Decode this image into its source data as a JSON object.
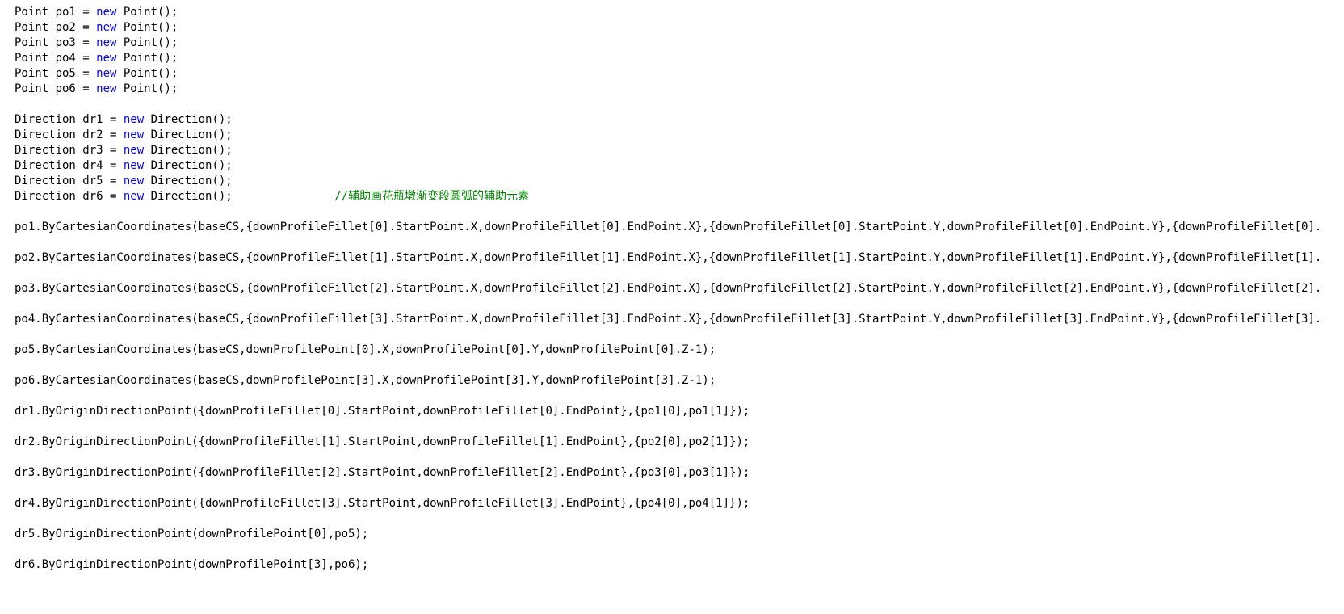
{
  "code": {
    "lines": [
      [
        {
          "t": "Point po1 = "
        },
        {
          "t": "new",
          "c": "kw"
        },
        {
          "t": " Point();"
        }
      ],
      [
        {
          "t": "Point po2 = "
        },
        {
          "t": "new",
          "c": "kw"
        },
        {
          "t": " Point();"
        }
      ],
      [
        {
          "t": "Point po3 = "
        },
        {
          "t": "new",
          "c": "kw"
        },
        {
          "t": " Point();"
        }
      ],
      [
        {
          "t": "Point po4 = "
        },
        {
          "t": "new",
          "c": "kw"
        },
        {
          "t": " Point();"
        }
      ],
      [
        {
          "t": "Point po5 = "
        },
        {
          "t": "new",
          "c": "kw"
        },
        {
          "t": " Point();"
        }
      ],
      [
        {
          "t": "Point po6 = "
        },
        {
          "t": "new",
          "c": "kw"
        },
        {
          "t": " Point();"
        }
      ],
      [
        {
          "t": ""
        }
      ],
      [
        {
          "t": "Direction dr1 = "
        },
        {
          "t": "new",
          "c": "kw"
        },
        {
          "t": " Direction();"
        }
      ],
      [
        {
          "t": "Direction dr2 = "
        },
        {
          "t": "new",
          "c": "kw"
        },
        {
          "t": " Direction();"
        }
      ],
      [
        {
          "t": "Direction dr3 = "
        },
        {
          "t": "new",
          "c": "kw"
        },
        {
          "t": " Direction();"
        }
      ],
      [
        {
          "t": "Direction dr4 = "
        },
        {
          "t": "new",
          "c": "kw"
        },
        {
          "t": " Direction();"
        }
      ],
      [
        {
          "t": "Direction dr5 = "
        },
        {
          "t": "new",
          "c": "kw"
        },
        {
          "t": " Direction();"
        }
      ],
      [
        {
          "t": "Direction dr6 = "
        },
        {
          "t": "new",
          "c": "kw"
        },
        {
          "t": " Direction();               "
        },
        {
          "t": "//辅助画花瓶墩渐变段圆弧的辅助元素",
          "c": "cm"
        }
      ],
      [
        {
          "t": ""
        }
      ],
      [
        {
          "t": "po1.ByCartesianCoordinates(baseCS,{downProfileFillet[0].StartPoint.X,downProfileFillet[0].EndPoint.X},{downProfileFillet[0].StartPoint.Y,downProfileFillet[0].EndPoint.Y},{downProfileFillet[0]."
        }
      ],
      [
        {
          "t": ""
        }
      ],
      [
        {
          "t": "po2.ByCartesianCoordinates(baseCS,{downProfileFillet[1].StartPoint.X,downProfileFillet[1].EndPoint.X},{downProfileFillet[1].StartPoint.Y,downProfileFillet[1].EndPoint.Y},{downProfileFillet[1]."
        }
      ],
      [
        {
          "t": ""
        }
      ],
      [
        {
          "t": "po3.ByCartesianCoordinates(baseCS,{downProfileFillet[2].StartPoint.X,downProfileFillet[2].EndPoint.X},{downProfileFillet[2].StartPoint.Y,downProfileFillet[2].EndPoint.Y},{downProfileFillet[2]."
        }
      ],
      [
        {
          "t": ""
        }
      ],
      [
        {
          "t": "po4.ByCartesianCoordinates(baseCS,{downProfileFillet[3].StartPoint.X,downProfileFillet[3].EndPoint.X},{downProfileFillet[3].StartPoint.Y,downProfileFillet[3].EndPoint.Y},{downProfileFillet[3]."
        }
      ],
      [
        {
          "t": ""
        }
      ],
      [
        {
          "t": "po5.ByCartesianCoordinates(baseCS,downProfilePoint[0].X,downProfilePoint[0].Y,downProfilePoint[0].Z-1);"
        }
      ],
      [
        {
          "t": ""
        }
      ],
      [
        {
          "t": "po6.ByCartesianCoordinates(baseCS,downProfilePoint[3].X,downProfilePoint[3].Y,downProfilePoint[3].Z-1);"
        }
      ],
      [
        {
          "t": ""
        }
      ],
      [
        {
          "t": "dr1.ByOriginDirectionPoint({downProfileFillet[0].StartPoint,downProfileFillet[0].EndPoint},{po1[0],po1[1]});"
        }
      ],
      [
        {
          "t": ""
        }
      ],
      [
        {
          "t": "dr2.ByOriginDirectionPoint({downProfileFillet[1].StartPoint,downProfileFillet[1].EndPoint},{po2[0],po2[1]});"
        }
      ],
      [
        {
          "t": ""
        }
      ],
      [
        {
          "t": "dr3.ByOriginDirectionPoint({downProfileFillet[2].StartPoint,downProfileFillet[2].EndPoint},{po3[0],po3[1]});"
        }
      ],
      [
        {
          "t": ""
        }
      ],
      [
        {
          "t": "dr4.ByOriginDirectionPoint({downProfileFillet[3].StartPoint,downProfileFillet[3].EndPoint},{po4[0],po4[1]});"
        }
      ],
      [
        {
          "t": ""
        }
      ],
      [
        {
          "t": "dr5.ByOriginDirectionPoint(downProfilePoint[0],po5);"
        }
      ],
      [
        {
          "t": ""
        }
      ],
      [
        {
          "t": "dr6.ByOriginDirectionPoint(downProfilePoint[3],po6);"
        }
      ]
    ]
  }
}
